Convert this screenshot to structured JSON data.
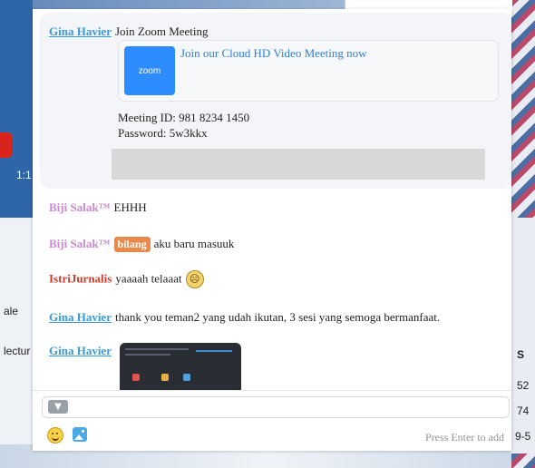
{
  "card": {
    "sender": "Gina Havier",
    "text": "Join Zoom Meeting",
    "link_title": "Join our Cloud HD Video Meeting now",
    "logo_text": "zoom",
    "meeting_id": "Meeting ID: 981 8234 1450",
    "password": "Password: 5w3kkx"
  },
  "messages": [
    {
      "sender": "Biji Salak™",
      "text": "EHHH"
    },
    {
      "sender": "Biji Salak™",
      "badge": "bilang",
      "text": "aku baru masuuk"
    },
    {
      "sender": "IstriJurnalis",
      "text": "yaaaah telaaat",
      "emoji": "crying-emoji"
    },
    {
      "sender": "Gina Havier",
      "text": "thank you teman2 yang udah ikutan, 3 sesi yang semoga bermanfaat."
    },
    {
      "sender": "Gina Havier",
      "attachment": "screenshot-image"
    }
  ],
  "input": {
    "hint": "Press Enter to add"
  },
  "background": {
    "left_texts": [
      "1:1",
      "ale",
      "lectur"
    ],
    "right_texts": [
      "S",
      "52",
      "74",
      "9-5"
    ]
  },
  "colors": {
    "gina": "#3a9ad9",
    "biji": "#c98ad0",
    "istri": "#cf3a2d",
    "badge": "#e88a4b",
    "zoom": "#2d8cff"
  }
}
